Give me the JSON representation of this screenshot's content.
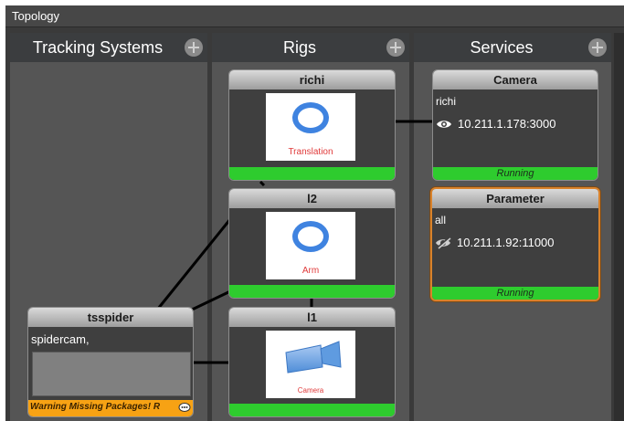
{
  "window": {
    "title": "Topology"
  },
  "columns": {
    "tracking": {
      "title": "Tracking Systems"
    },
    "rigs": {
      "title": "Rigs"
    },
    "services": {
      "title": "Services"
    }
  },
  "tracking_systems": [
    {
      "name": "tsspider",
      "subtitle": "spidercam,",
      "warning": "Warning Missing Packages! R",
      "warning_color": "#f7a214"
    }
  ],
  "rigs": [
    {
      "name": "richi",
      "thumbnail_label": "Translation",
      "status_color": "#2ecc2e"
    },
    {
      "name": "l2",
      "thumbnail_label": "Arm",
      "status_color": "#2ecc2e"
    },
    {
      "name": "l1",
      "thumbnail_label": "Camera",
      "status_color": "#2ecc2e"
    }
  ],
  "services": [
    {
      "name": "Camera",
      "scope": "richi",
      "address": "10.211.1.178:3000",
      "status": "Running",
      "icon": "eye-icon",
      "selected": false
    },
    {
      "name": "Parameter",
      "scope": "all",
      "address": "10.211.1.92:11000",
      "status": "Running",
      "icon": "eye-slash-icon",
      "selected": true,
      "highlight_color": "#d9822b"
    }
  ],
  "colors": {
    "running": "#2ecc2e",
    "accent_ring": "#3f83e0"
  }
}
